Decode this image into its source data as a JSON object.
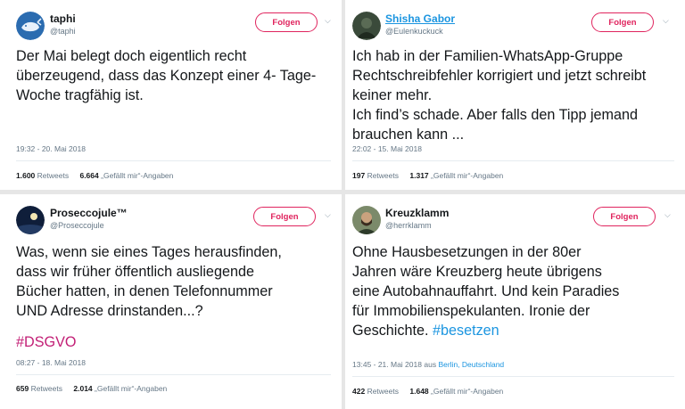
{
  "follow_label": "Folgen",
  "colors": {
    "follow_pink": "#e0245e",
    "link_blue": "#1b95e0",
    "hashtag_purple": "#c21e75",
    "divider": "#e6e6e6"
  },
  "tweets": [
    {
      "name": "taphi",
      "handle": "@taphi",
      "text": "Der Mai belegt doch eigentlich recht\nüberzeugend, dass das Konzept einer 4- Tage-\nWoche tragfähig ist.",
      "timestamp": "19:32 - 20. Mai 2018",
      "retweets": "1.600",
      "retweets_label": "Retweets",
      "likes": "6.664",
      "likes_label": "„Gefällt mir“-Angaben",
      "avatar_icon": "whale-avatar-icon"
    },
    {
      "name": "Shisha Gabor",
      "handle": "@Eulenkuckuck",
      "text": "Ich hab in der Familien-WhatsApp-Gruppe\nRechtschreibfehler korrigiert und jetzt schreibt\nkeiner mehr.\nIch find’s schade. Aber falls den Tipp jemand\nbrauchen kann ...",
      "timestamp": "22:02 - 15. Mai 2018",
      "retweets": "197",
      "retweets_label": "Retweets",
      "likes": "1.317",
      "likes_label": "„Gefällt mir“-Angaben",
      "avatar_icon": "dark-photo-avatar-icon"
    },
    {
      "name": "Proseccojule™",
      "handle": "@Proseccojule",
      "text": "Was, wenn sie eines Tages herausfinden,\ndass wir früher öffentlich ausliegende\nBücher hatten, in denen Telefonnummer\nUND Adresse drinstanden...?",
      "hashtag": "#DSGVO",
      "timestamp": "08:27 - 18. Mai 2018",
      "retweets": "659",
      "retweets_label": "Retweets",
      "likes": "2.014",
      "likes_label": "„Gefällt mir“-Angaben",
      "avatar_icon": "night-sky-avatar-icon"
    },
    {
      "name": "Kreuzklamm",
      "handle": "@herrklamm",
      "text": "Ohne Hausbesetzungen in der 80er\nJahren wäre Kreuzberg heute übrigens\neine Autobahnauffahrt. Und kein Paradies\nfür Immobilienspekulanten. Ironie der\nGeschichte. ",
      "hashtag": "#besetzen",
      "timestamp": "13:45 - 21. Mai 2018",
      "location_prefix": "aus",
      "location": "Berlin, Deutschland",
      "retweets": "422",
      "retweets_label": "Retweets",
      "likes": "1.648",
      "likes_label": "„Gefällt mir“-Angaben",
      "avatar_icon": "bearded-man-avatar-icon"
    }
  ]
}
